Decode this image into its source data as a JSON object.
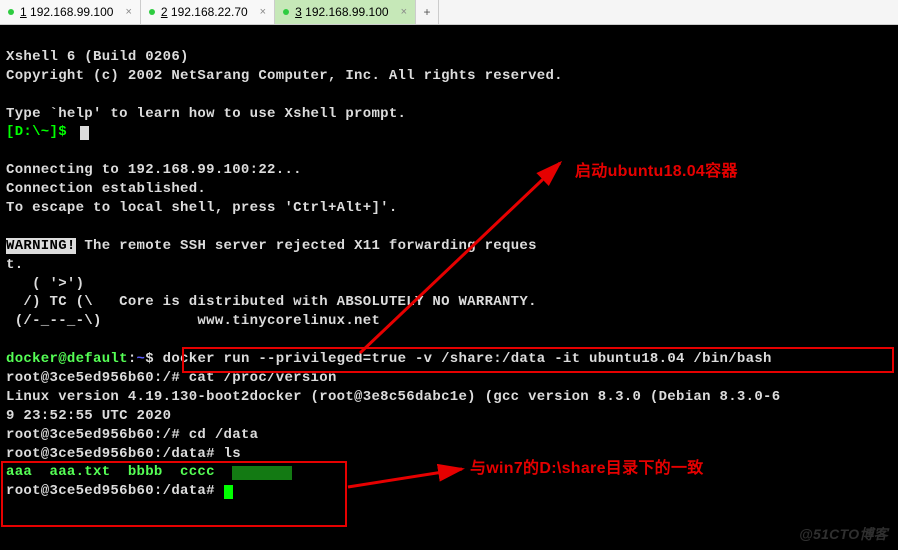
{
  "tabs": [
    {
      "num": "1",
      "label": "192.168.99.100"
    },
    {
      "num": "2",
      "label": "192.168.22.70"
    },
    {
      "num": "3",
      "label": "192.168.99.100"
    }
  ],
  "banner": {
    "version": "Xshell 6 (Build 0206)",
    "copyright": "Copyright (c) 2002 NetSarang Computer, Inc. All rights reserved.",
    "help": "Type `help' to learn how to use Xshell prompt.",
    "prompt": "[D:\\~]$"
  },
  "connect": {
    "l1": "Connecting to 192.168.99.100:22...",
    "l2": "Connection established.",
    "l3": "To escape to local shell, press 'Ctrl+Alt+]'."
  },
  "warn": {
    "tag": "WARNING!",
    "text": " The remote SSH server rejected X11 forwarding reques",
    "t": "t.",
    "a1": "   ( '>')",
    "a2": "  /) TC (\\   Core is distributed with ABSOLUTELY NO WARRANTY.",
    "a3": " (/-_--_-\\)           www.tinycorelinux.net"
  },
  "docker": {
    "prompt": "docker@default",
    "sep": ":",
    "path": "~",
    "dollar": "$ ",
    "cmd": "docker run --privileged=true -v /share:/data -it ubuntu18.04 /bin/bash"
  },
  "root": {
    "p1": "root@3ce5ed956b60:/# cat /proc/version",
    "ver": "Linux version 4.19.130-boot2docker (root@3e8c56dabc1e) (gcc version 8.3.0 (Debian 8.3.0-6",
    "ver2": "9 23:52:55 UTC 2020",
    "cd": "root@3ce5ed956b60:/# cd /data",
    "ls": "root@3ce5ed956b60:/data# ls",
    "files": "aaa  aaa.txt  bbbb  cccc  ",
    "last": "root@3ce5ed956b60:/data# "
  },
  "annotations": {
    "a1": "启动ubuntu18.04容器",
    "a2": "与win7的D:\\share目录下的一致"
  },
  "watermark": "@51CTO博客"
}
